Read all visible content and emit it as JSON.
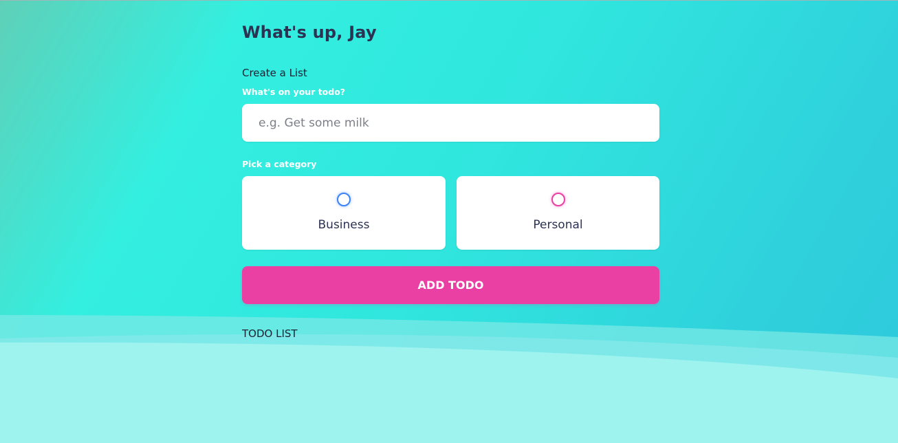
{
  "header": {
    "greeting": "What's up, Jay"
  },
  "create": {
    "title": "Create a List",
    "todo_label": "What's on your todo?",
    "todo_placeholder": "e.g. Get some milk",
    "todo_value": "",
    "category_label": "Pick a category",
    "categories": [
      {
        "label": "Business",
        "color": "#3a82f7",
        "selected": false
      },
      {
        "label": "Personal",
        "color": "#ea40a4",
        "selected": false
      }
    ],
    "add_button_label": "ADD TODO"
  },
  "list": {
    "title": "TODO LIST"
  },
  "colors": {
    "accent_pink": "#ea40a4",
    "business_blue": "#3a82f7",
    "text_dark": "#2b3252",
    "background_teal": "#33efe0"
  }
}
